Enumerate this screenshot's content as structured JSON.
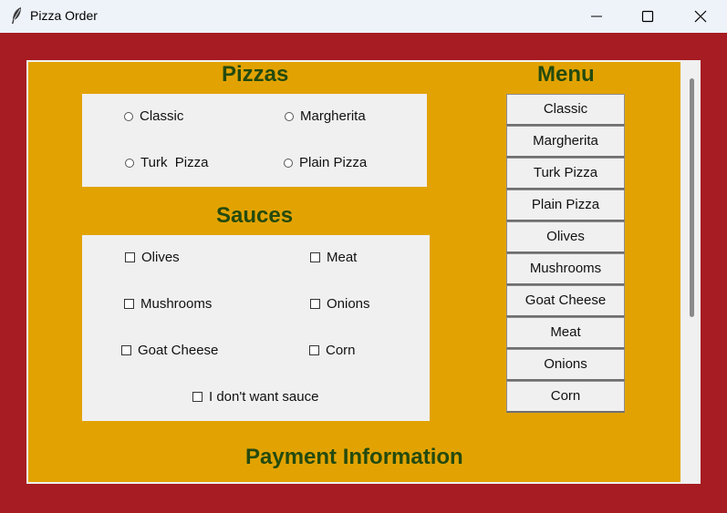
{
  "window": {
    "title": "Pizza Order",
    "icon": "feather-icon",
    "controls": [
      "minimize-icon",
      "maximize-icon",
      "close-icon"
    ]
  },
  "colors": {
    "frame": "#a61c22",
    "canvas": "#e2a302",
    "heading": "#244a0f",
    "panel": "#f0f0f0"
  },
  "pizzas": {
    "heading": "Pizzas",
    "options": [
      "Classic",
      "Margherita",
      "Turk  Pizza",
      "Plain Pizza"
    ]
  },
  "sauces": {
    "heading": "Sauces",
    "options": [
      "Olives",
      "Meat",
      "Mushrooms",
      "Onions",
      "Goat Cheese",
      "Corn"
    ],
    "no_sauce": "I don't want sauce"
  },
  "menu": {
    "heading": "Menu",
    "items": [
      "Classic",
      "Margherita",
      "Turk Pizza",
      "Plain Pizza",
      "Olives",
      "Mushrooms",
      "Goat Cheese",
      "Meat",
      "Onions",
      "Corn"
    ]
  },
  "payment": {
    "heading": "Payment Information"
  }
}
